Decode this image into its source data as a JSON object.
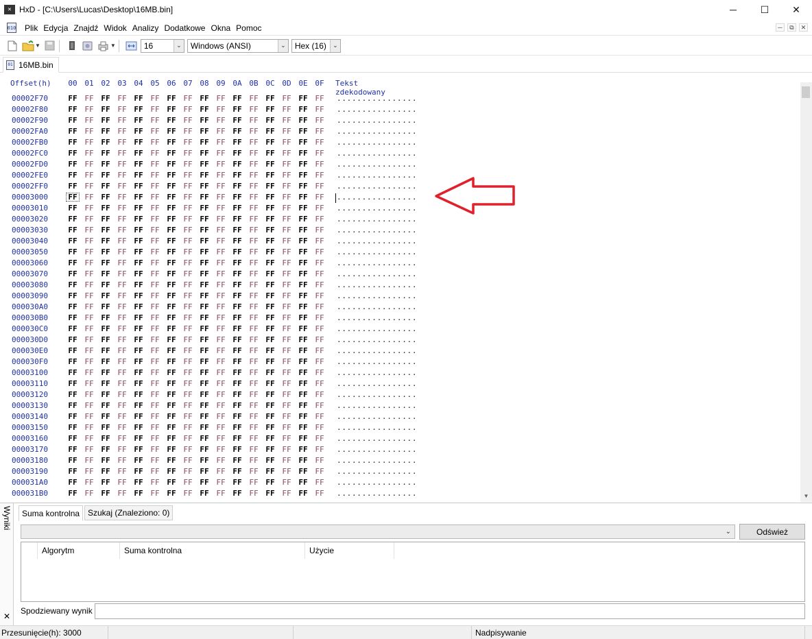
{
  "window": {
    "title": "HxD - [C:\\Users\\Lucas\\Desktop\\16MB.bin]",
    "icon_text": "HxD",
    "controls": [
      "─",
      "☐",
      "✕"
    ]
  },
  "menu": {
    "items": [
      "Plik",
      "Edycja",
      "Znajdź",
      "Widok",
      "Analizy",
      "Dodatkowe",
      "Okna",
      "Pomoc"
    ],
    "mdi_controls": [
      "─",
      "⧉",
      "✕"
    ]
  },
  "toolbar": {
    "bytes_per_row": "16",
    "charset": "Windows (ANSI)",
    "offset_base": "Hex (16)",
    "icons": [
      "new-file-icon",
      "open-file-icon",
      "save-icon",
      "ram-icon",
      "disk-icon",
      "print-icon",
      "bytes-per-row-icon"
    ]
  },
  "document_tab": {
    "label": "16MB.bin"
  },
  "hex_view": {
    "header": {
      "offset": "Offset(h)",
      "columns": [
        "00",
        "01",
        "02",
        "03",
        "04",
        "05",
        "06",
        "07",
        "08",
        "09",
        "0A",
        "0B",
        "0C",
        "0D",
        "0E",
        "0F"
      ],
      "decoded": "Tekst zdekodowany"
    },
    "byte_value": "FF",
    "decoded_text": "................",
    "cursor_offset": "00003000",
    "rows": [
      "00002F70",
      "00002F80",
      "00002F90",
      "00002FA0",
      "00002FB0",
      "00002FC0",
      "00002FD0",
      "00002FE0",
      "00002FF0",
      "00003000",
      "00003010",
      "00003020",
      "00003030",
      "00003040",
      "00003050",
      "00003060",
      "00003070",
      "00003080",
      "00003090",
      "000030A0",
      "000030B0",
      "000030C0",
      "000030D0",
      "000030E0",
      "000030F0",
      "00003100",
      "00003110",
      "00003120",
      "00003130",
      "00003140",
      "00003150",
      "00003160",
      "00003170",
      "00003180",
      "00003190",
      "000031A0",
      "000031B0"
    ]
  },
  "results_panel": {
    "side_label": "Wyniki",
    "side_close": "✕",
    "tabs": [
      "Suma kontrolna",
      "Szukaj (Znaleziono: 0)"
    ],
    "active_tab": "Suma kontrolna",
    "refresh_button": "Odśwież",
    "columns": [
      "Algorytm",
      "Suma kontrolna",
      "Użycie"
    ],
    "expected_label": "Spodziewany wynik",
    "expected_value": ""
  },
  "statusbar": {
    "offset": "Przesunięcie(h): 3000",
    "mode": "Nadpisywanie"
  },
  "colors": {
    "offset_blue": "#1f2fa8",
    "byte_odd": "#8a4c57",
    "annotation_red": "#e0202a"
  }
}
